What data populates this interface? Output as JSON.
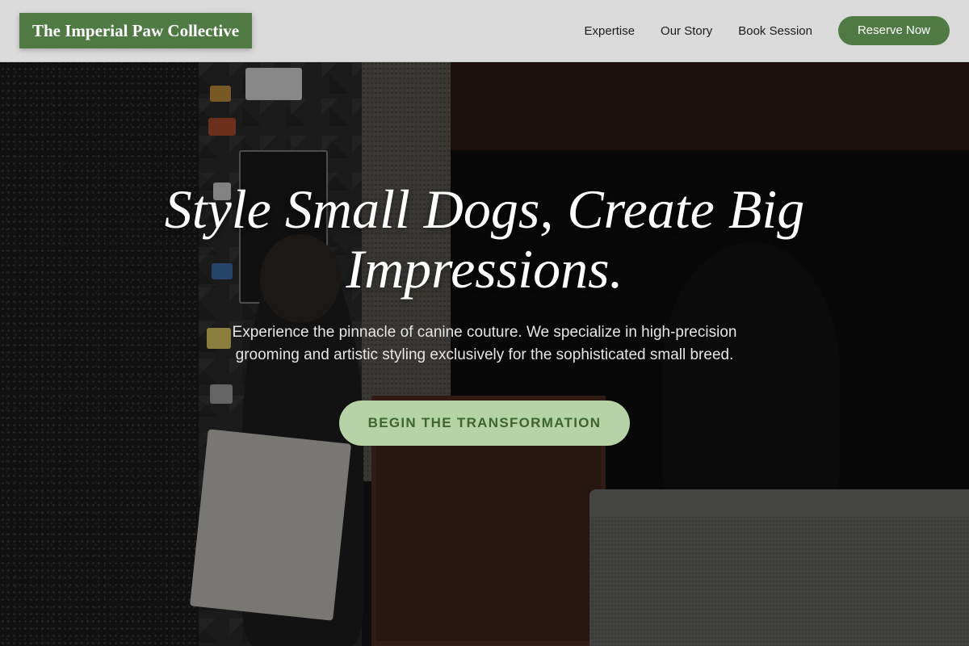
{
  "header": {
    "brand": "The Imperial Paw Collective",
    "nav_links": [
      "Expertise",
      "Our Story",
      "Book Session"
    ],
    "cta": "Reserve Now"
  },
  "hero": {
    "headline": "Style Small Dogs, Create Big Impressions.",
    "subheadline": "Experience the pinnacle of canine couture. We specialize in high-precision grooming and artistic styling exclusively for the sophisticated small breed.",
    "cta": "BEGIN THE TRANSFORMATION"
  },
  "colors": {
    "brand_green": "#4f7a43",
    "cta_light_green": "#b5d3a7",
    "cta_text": "#3d6533",
    "nav_background": "#ebebeb"
  }
}
